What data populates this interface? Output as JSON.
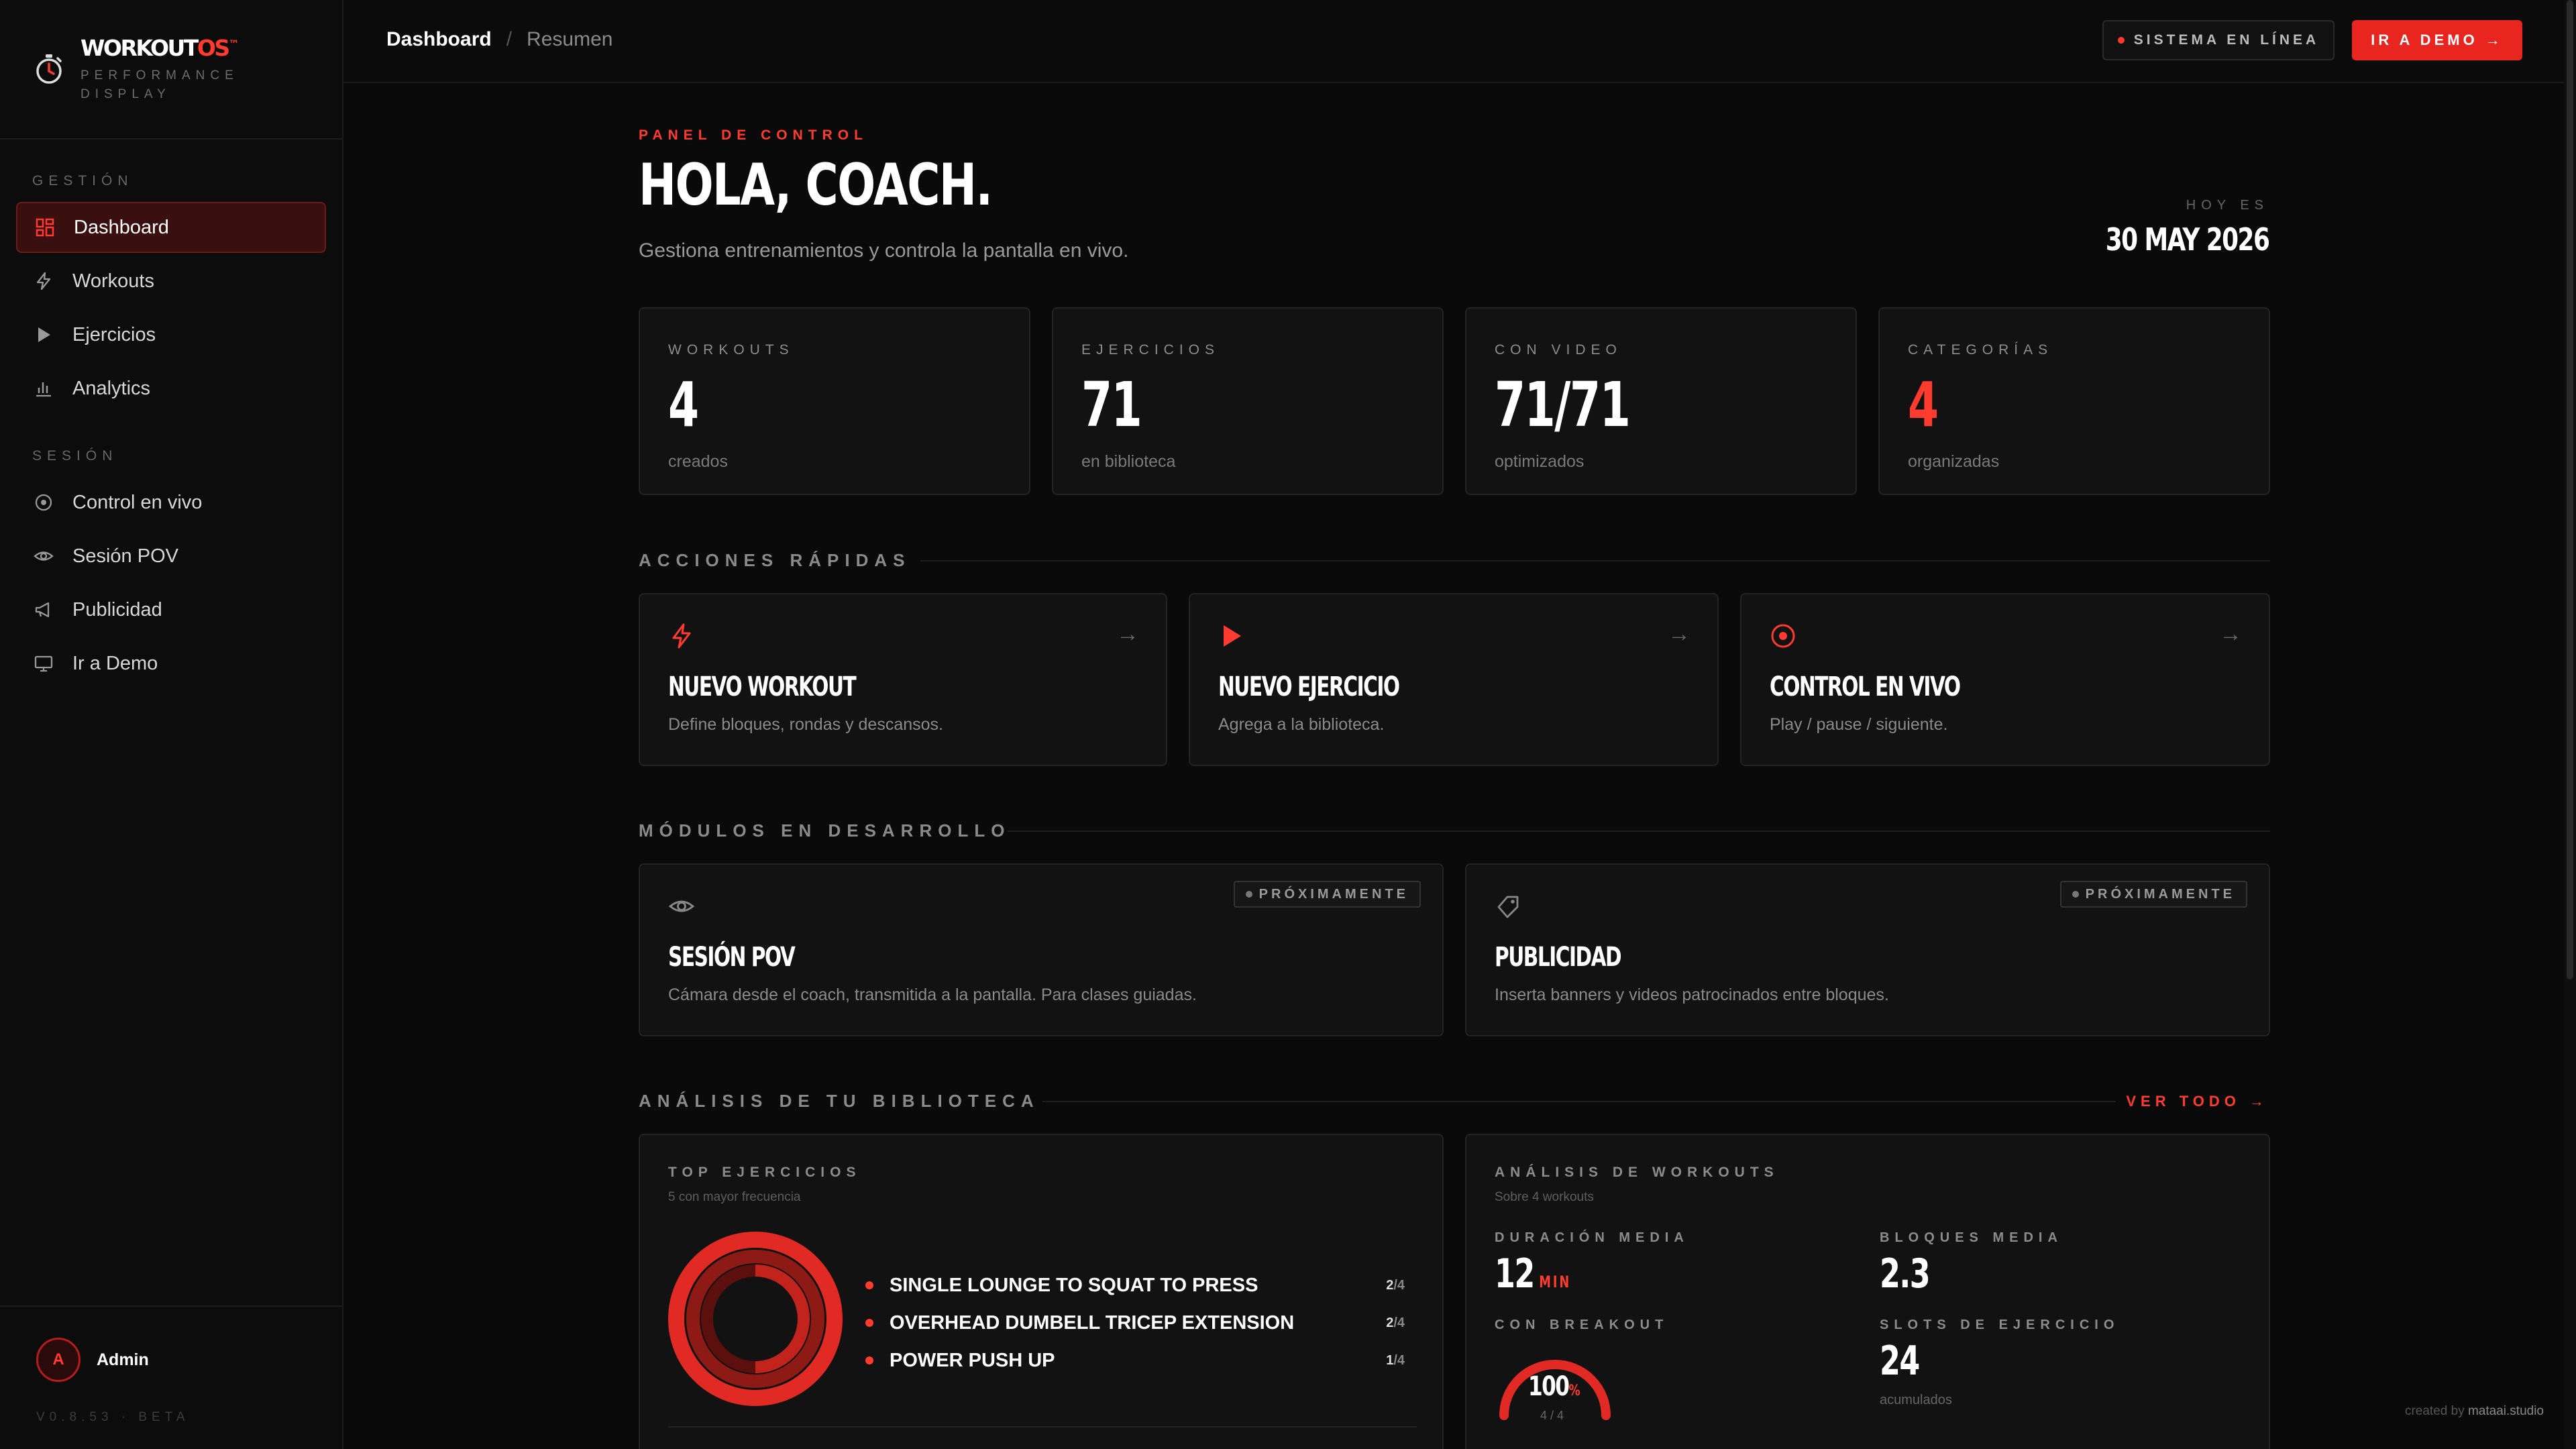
{
  "brand": {
    "name_main": "WORKOUT",
    "name_accent": "OS",
    "tm": "™",
    "subtitle": "PERFORMANCE DISPLAY"
  },
  "sidebar": {
    "section_gestion": "GESTIÓN",
    "section_sesion": "SESIÓN",
    "items": [
      {
        "label": "Dashboard",
        "icon": "grid-icon",
        "active": true
      },
      {
        "label": "Workouts",
        "icon": "bolt-icon"
      },
      {
        "label": "Ejercicios",
        "icon": "play-icon"
      },
      {
        "label": "Analytics",
        "icon": "bar-chart-icon"
      },
      {
        "label": "Control en vivo",
        "icon": "target-icon"
      },
      {
        "label": "Sesión POV",
        "icon": "eye-icon"
      },
      {
        "label": "Publicidad",
        "icon": "megaphone-icon"
      },
      {
        "label": "Ir a Demo",
        "icon": "monitor-icon"
      }
    ],
    "user": {
      "initial": "A",
      "name": "Admin"
    },
    "version": "V0.8.53 · BETA"
  },
  "topbar": {
    "breadcrumb_current": "Dashboard",
    "breadcrumb_sep": "/",
    "breadcrumb_sub": "Resumen",
    "status": "SISTEMA EN LÍNEA",
    "demo_button": "IR A DEMO →"
  },
  "hero": {
    "eyebrow": "PANEL DE CONTROL",
    "title": "HOLA, COACH.",
    "subtitle": "Gestiona entrenamientos y controla la pantalla en vivo.",
    "today_label": "HOY ES",
    "today_date": "30 MAY 2026"
  },
  "stats": [
    {
      "label": "WORKOUTS",
      "value": "4",
      "sub": "creados"
    },
    {
      "label": "EJERCICIOS",
      "value": "71",
      "sub": "en biblioteca"
    },
    {
      "label": "CON VIDEO",
      "value": "71/71",
      "sub": "optimizados"
    },
    {
      "label": "CATEGORÍAS",
      "value": "4",
      "sub": "organizadas",
      "accent": true
    }
  ],
  "quick_actions": {
    "title": "ACCIONES RÁPIDAS",
    "items": [
      {
        "title": "NUEVO WORKOUT",
        "desc": "Define bloques, rondas y descansos.",
        "icon": "bolt-icon",
        "arrow": "→"
      },
      {
        "title": "NUEVO EJERCICIO",
        "desc": "Agrega a la biblioteca.",
        "icon": "play-icon",
        "arrow": "→"
      },
      {
        "title": "CONTROL EN VIVO",
        "desc": "Play / pause / siguiente.",
        "icon": "target-icon",
        "arrow": "→"
      }
    ]
  },
  "modules": {
    "title": "MÓDULOS EN DESARROLLO",
    "items": [
      {
        "title": "SESIÓN POV",
        "desc": "Cámara desde el coach, transmitida a la pantalla. Para clases guiadas.",
        "badge": "PRÓXIMAMENTE",
        "icon": "eye-icon"
      },
      {
        "title": "PUBLICIDAD",
        "desc": "Inserta banners y videos patrocinados entre bloques.",
        "badge": "PRÓXIMAMENTE",
        "icon": "tag-icon"
      }
    ]
  },
  "analysis": {
    "title": "ANÁLISIS DE TU BIBLIOTECA",
    "see_all": "VER TODO →",
    "top": {
      "title": "TOP EJERCICIOS",
      "subtitle": "5 con mayor frecuencia",
      "items": [
        {
          "name": "SINGLE LOUNGE TO SQUAT TO PRESS",
          "count": "2",
          "total": "/4"
        },
        {
          "name": "OVERHEAD DUMBELL TRICEP EXTENSION",
          "count": "2",
          "total": "/4"
        },
        {
          "name": "POWER PUSH UP",
          "count": "1",
          "total": "/4"
        }
      ]
    },
    "workouts": {
      "title": "ANÁLISIS DE WORKOUTS",
      "subtitle": "Sobre 4 workouts",
      "duration_label": "DURACIÓN MEDIA",
      "duration_value": "12",
      "duration_unit": "MIN",
      "blocks_label": "BLOQUES MEDIA",
      "blocks_value": "2.3",
      "breakout_label": "CON BREAKOUT",
      "breakout_value": "100",
      "breakout_unit": "%",
      "breakout_ratio": "4 / 4",
      "slots_label": "SLOTS DE EJERCICIO",
      "slots_value": "24",
      "slots_sub": "acumulados"
    }
  },
  "credit": {
    "prefix": "created by",
    "name": "mataai.studio"
  },
  "colors": {
    "accent": "#ff3b30",
    "background": "#0a0a0a",
    "card": "#121212"
  }
}
